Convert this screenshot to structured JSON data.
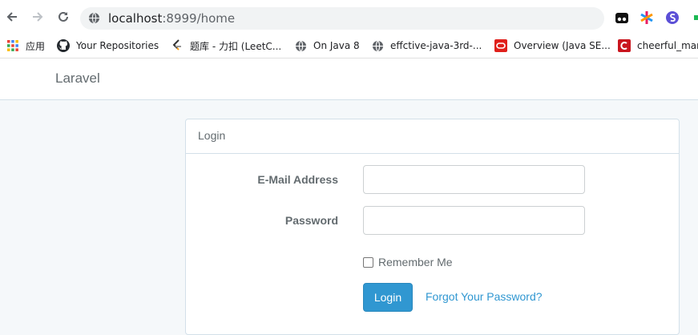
{
  "browser": {
    "url_host": "localhost",
    "url_rest": ":8999/home",
    "bookmarks": [
      {
        "label": "应用",
        "icon": "apps-grid-icon"
      },
      {
        "label": "Your Repositories",
        "icon": "github-icon"
      },
      {
        "label": "题库 - 力扣 (LeetC...",
        "icon": "leetcode-icon"
      },
      {
        "label": "On Java 8",
        "icon": "globe-icon"
      },
      {
        "label": "effctive-java-3rd-...",
        "icon": "globe-icon"
      },
      {
        "label": "Overview (Java SE...",
        "icon": "oracle-icon"
      },
      {
        "label": "cheerful_man",
        "icon": "c-icon"
      }
    ]
  },
  "app": {
    "brand": "Laravel"
  },
  "login": {
    "heading": "Login",
    "email_label": "E-Mail Address",
    "email_value": "",
    "password_label": "Password",
    "password_value": "",
    "remember_label": "Remember Me",
    "remember_checked": false,
    "submit_label": "Login",
    "forgot_label": "Forgot Your Password?"
  },
  "colors": {
    "accent": "#3097d1",
    "page_bg": "#f5f8fa",
    "text": "#636b6f"
  }
}
